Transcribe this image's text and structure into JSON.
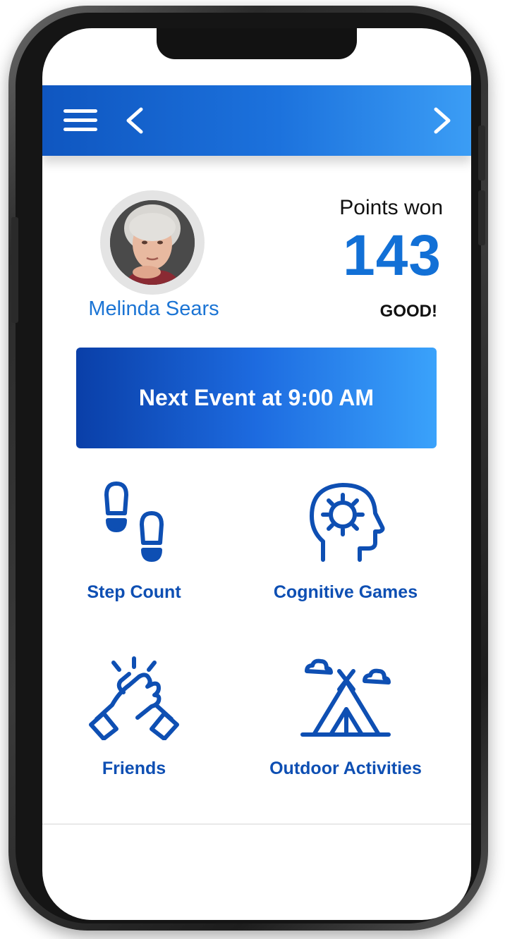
{
  "header": {
    "menu_icon": "hamburger-menu-icon",
    "back_icon": "chevron-left-icon",
    "forward_icon": "chevron-right-icon",
    "background_start": "#0f56c0",
    "background_end": "#3b9df5"
  },
  "profile": {
    "name": "Melinda Sears",
    "avatar": "user-avatar-photo"
  },
  "points": {
    "label": "Points won",
    "value": "143",
    "status": "GOOD!",
    "value_color": "#1270d6"
  },
  "event": {
    "label": "Next Event at 9:00 AM"
  },
  "tiles": [
    {
      "label": "Step Count",
      "icon": "footsteps-icon"
    },
    {
      "label": "Cognitive Games",
      "icon": "brain-gear-icon"
    },
    {
      "label": "Friends",
      "icon": "handshake-icon"
    },
    {
      "label": "Outdoor Activities",
      "icon": "tent-icon"
    }
  ],
  "colors": {
    "accent": "#0e4fb3",
    "name_color": "#1b74d4"
  }
}
